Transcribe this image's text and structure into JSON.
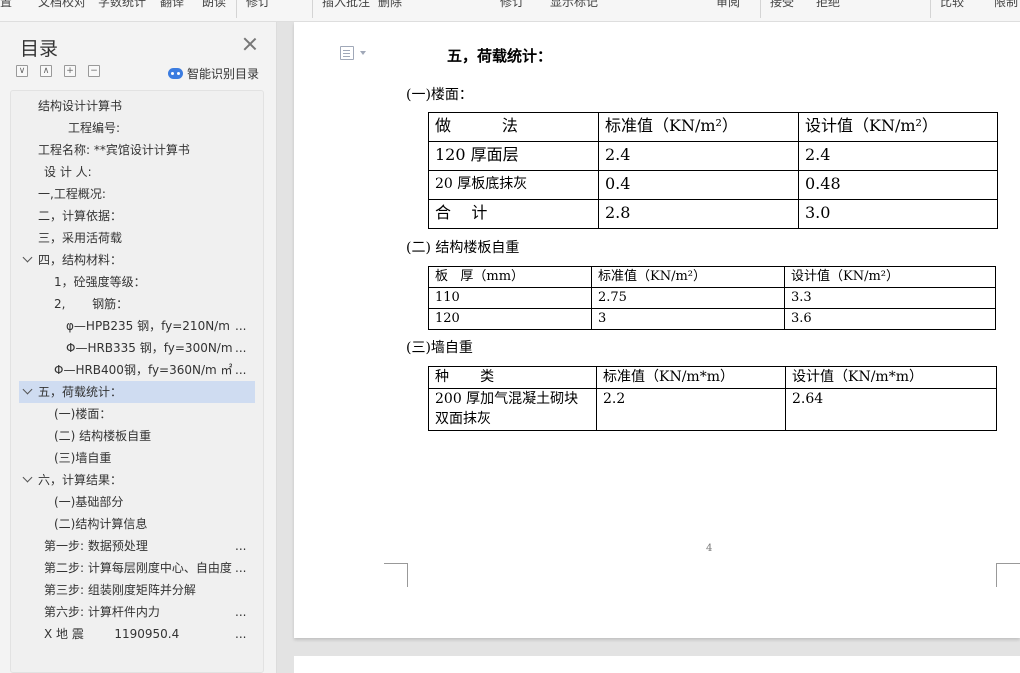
{
  "toolbar": {
    "items": [
      "置",
      "文档校对",
      "字数统计",
      "翻译",
      "朗读",
      "修订",
      "插入批注",
      "删除",
      "修订",
      "显示标记",
      "审阅",
      "接受",
      "拒绝",
      "比较",
      "限制"
    ]
  },
  "sidebar": {
    "title": "目录",
    "controls": [
      "∨",
      "∧",
      "+",
      "−"
    ],
    "smart_toc_label": "智能识别目录",
    "items": [
      {
        "text": "结构设计计算书",
        "ell": ""
      },
      {
        "text": "工程编号:",
        "ell": ""
      },
      {
        "text": "工程名称: **宾馆设计计算书",
        "ell": ""
      },
      {
        "text": "设 计 人:",
        "ell": ""
      },
      {
        "text": "一,工程概况:",
        "ell": ""
      },
      {
        "text": "二，计算依据：",
        "ell": ""
      },
      {
        "text": "三，采用活荷载",
        "ell": ""
      },
      {
        "text": "四，结构材料：",
        "ell": ""
      },
      {
        "text": "1，砼强度等级：",
        "ell": ""
      },
      {
        "text": "2,       钢筋：",
        "ell": ""
      },
      {
        "text": "φ—HPB235 钢，fy=210N/m",
        "ell": "..."
      },
      {
        "text": "Φ—HRB335 钢，fy=300N/m",
        "ell": "..."
      },
      {
        "text": "Φ—HRB400钢，fy=360N/m ㎡(",
        "ell": "..."
      },
      {
        "text": "五，荷载统计：",
        "ell": ""
      },
      {
        "text": "(一)楼面：",
        "ell": ""
      },
      {
        "text": "(二) 结构楼板自重",
        "ell": ""
      },
      {
        "text": "(三)墙自重",
        "ell": ""
      },
      {
        "text": "六，计算结果：",
        "ell": ""
      },
      {
        "text": "(一)基础部分",
        "ell": ""
      },
      {
        "text": "(二)结构计算信息",
        "ell": ""
      },
      {
        "text": "第一步: 数据预处理",
        "ell": "..."
      },
      {
        "text": "第二步: 计算每层刚度中心、自由度",
        "ell": "..."
      },
      {
        "text": "第三步: 组装刚度矩阵并分解",
        "ell": ""
      },
      {
        "text": "第六步: 计算杆件内力",
        "ell": "..."
      },
      {
        "text": "X 地 震        1190950.4",
        "ell": "..."
      }
    ]
  },
  "doc": {
    "section_title": "五，荷载统计：",
    "floor_heading": "(一)楼面：",
    "floor_table": {
      "headers": [
        "做          法",
        "标准值（KN/m²）",
        "设计值（KN/m²）"
      ],
      "rows": [
        [
          "120 厚面层",
          "2.4",
          "2.4"
        ],
        [
          "20 厚板底抹灰",
          "0.4",
          "0.48"
        ],
        [
          "合    计",
          "2.8",
          "3.0"
        ]
      ]
    },
    "slab_heading": "(二) 结构楼板自重",
    "slab_table": {
      "headers": [
        "板   厚（mm）",
        "标准值（KN/m²）",
        "设计值（KN/m²）"
      ],
      "rows": [
        [
          "110",
          "2.75",
          "3.3"
        ],
        [
          "120",
          "3",
          "3.6"
        ]
      ]
    },
    "wall_heading": "(三)墙自重",
    "wall_table": {
      "headers": [
        "种       类",
        "标准值（KN/m*m）",
        "设计值（KN/m*m）"
      ],
      "rows": [
        [
          "200 厚加气混凝土砌块双面抹灰",
          "2.2",
          "2.64"
        ]
      ]
    },
    "page_number": "4"
  }
}
